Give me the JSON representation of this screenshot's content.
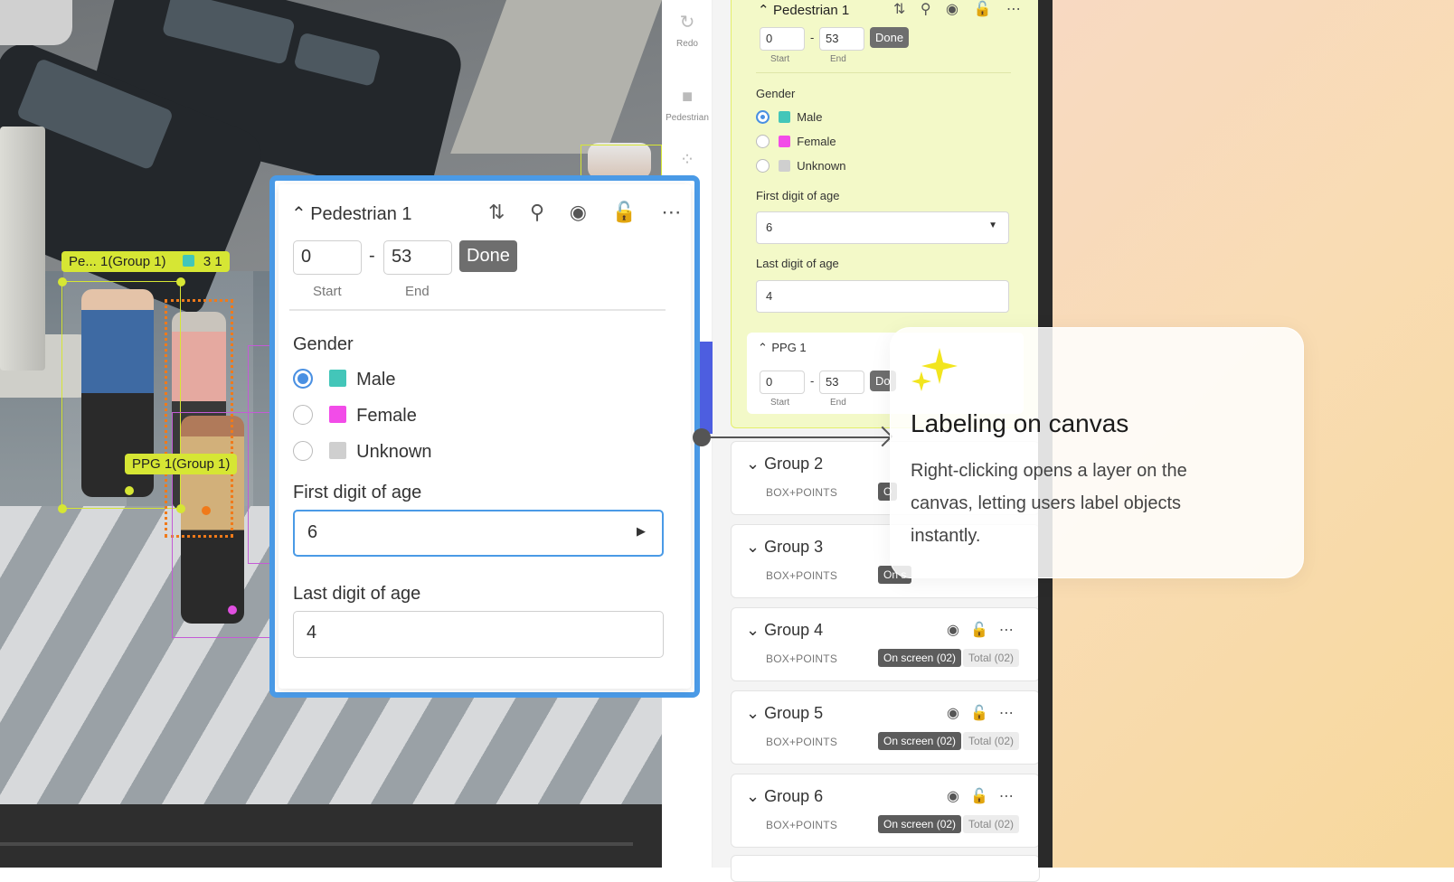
{
  "canvas": {
    "tag_pedestrian": "Pe... 1(Group 1)",
    "tag_pedestrian_count": "3 1",
    "tag_ppg": "PPG 1(Group 1)"
  },
  "tools": [
    {
      "label": "Redo",
      "icon": "redo-icon"
    },
    {
      "label": "Pedestrian",
      "icon": "pedestrian-icon"
    }
  ],
  "panel": {
    "pedestrian_card": {
      "title": "Pedestrian 1",
      "start": "0",
      "end": "53",
      "done": "Done",
      "start_label": "Start",
      "end_label": "End",
      "gender_label": "Gender",
      "genders": [
        {
          "label": "Male",
          "color": "#43c6b9",
          "selected": true
        },
        {
          "label": "Female",
          "color": "#f24ce8",
          "selected": false
        },
        {
          "label": "Unknown",
          "color": "#cfcfcf",
          "selected": false
        }
      ],
      "first_digit_label": "First digit of age",
      "first_digit_value": "6",
      "last_digit_label": "Last digit of age",
      "last_digit_value": "4"
    },
    "ppg_card": {
      "title": "PPG 1",
      "start": "0",
      "end": "53",
      "done": "Do",
      "start_label": "Start",
      "end_label": "End"
    },
    "groups": [
      {
        "title": "Group 2",
        "type": "BOX+POINTS",
        "on_screen": "O",
        "total": ""
      },
      {
        "title": "Group 3",
        "type": "BOX+POINTS",
        "on_screen": "On s",
        "total": ""
      },
      {
        "title": "Group 4",
        "type": "BOX+POINTS",
        "on_screen": "On screen (02)",
        "total": "Total (02)"
      },
      {
        "title": "Group 5",
        "type": "BOX+POINTS",
        "on_screen": "On screen (02)",
        "total": "Total (02)"
      },
      {
        "title": "Group 6",
        "type": "BOX+POINTS",
        "on_screen": "On screen (02)",
        "total": "Total (02)"
      }
    ]
  },
  "popup": {
    "title": "Pedestrian 1",
    "start": "0",
    "end": "53",
    "done": "Done",
    "start_label": "Start",
    "end_label": "End",
    "gender_label": "Gender",
    "genders": [
      {
        "label": "Male",
        "color": "#43c6b9",
        "selected": true
      },
      {
        "label": "Female",
        "color": "#f24ce8",
        "selected": false
      },
      {
        "label": "Unknown",
        "color": "#cfcfcf",
        "selected": false
      }
    ],
    "first_digit_label": "First digit of age",
    "first_digit_value": "6",
    "last_digit_label": "Last digit of age",
    "last_digit_value": "4"
  },
  "callout": {
    "title": "Labeling on canvas",
    "body": "Right-clicking opens a layer on the canvas, letting users label objects instantly."
  },
  "colors": {
    "accent_blue": "#4a9ae6",
    "label_yellow": "#d6e634",
    "bbox_orange": "#f07a1a",
    "bbox_purple": "#c45bd6"
  }
}
